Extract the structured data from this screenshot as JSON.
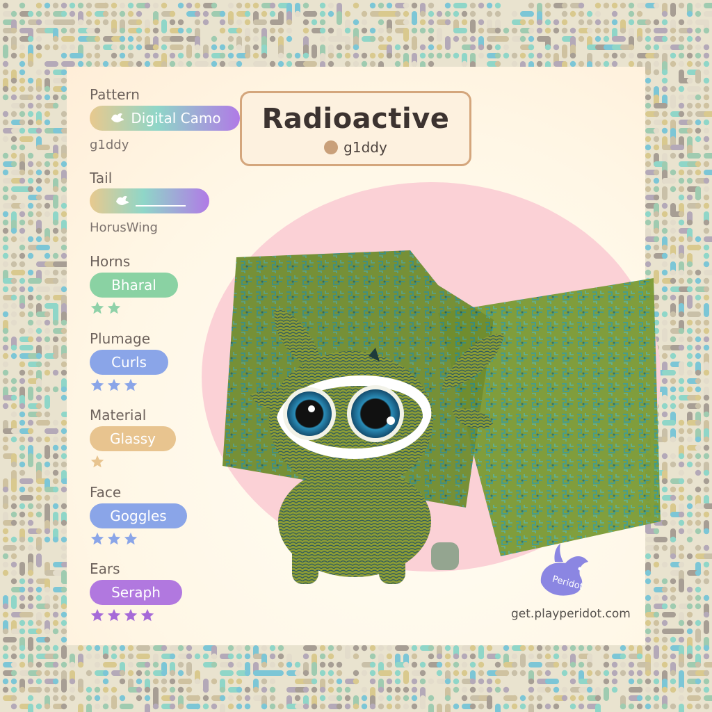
{
  "card": {
    "title": "Radioactive",
    "owner": "g1ddy",
    "url": "get.playperidot.com",
    "logo_text": "Peridot"
  },
  "traits": [
    {
      "label": "Pattern",
      "value": "Digital Camo",
      "sub": "g1ddy",
      "stars": 0,
      "style": "rainbow",
      "icon": "peridot-bird-icon"
    },
    {
      "label": "Tail",
      "value": "",
      "sub": "HorusWing",
      "stars": 0,
      "style": "rainbow",
      "icon": "peridot-bird-icon"
    },
    {
      "label": "Horns",
      "value": "Bharal",
      "sub": "",
      "stars": 2,
      "style": "green"
    },
    {
      "label": "Plumage",
      "value": "Curls",
      "sub": "",
      "stars": 3,
      "style": "blue"
    },
    {
      "label": "Material",
      "value": "Glassy",
      "sub": "",
      "stars": 1,
      "style": "tan"
    },
    {
      "label": "Face",
      "value": "Goggles",
      "sub": "",
      "stars": 3,
      "style": "blue"
    },
    {
      "label": "Ears",
      "value": "Seraph",
      "sub": "",
      "stars": 4,
      "style": "purple"
    }
  ],
  "colors": {
    "green": "#8ad2a3",
    "blue": "#8aa5e8",
    "tan": "#e8c48f",
    "purple": "#b178df",
    "rainbow_start": "#e8c98e",
    "rainbow_mid": "#8fd6c8",
    "rainbow_end": "#b07ae6",
    "star_green": "#8fd1a8",
    "star_blue": "#8aa5e8",
    "star_tan": "#e8c48f",
    "star_purple": "#a66ad8"
  }
}
